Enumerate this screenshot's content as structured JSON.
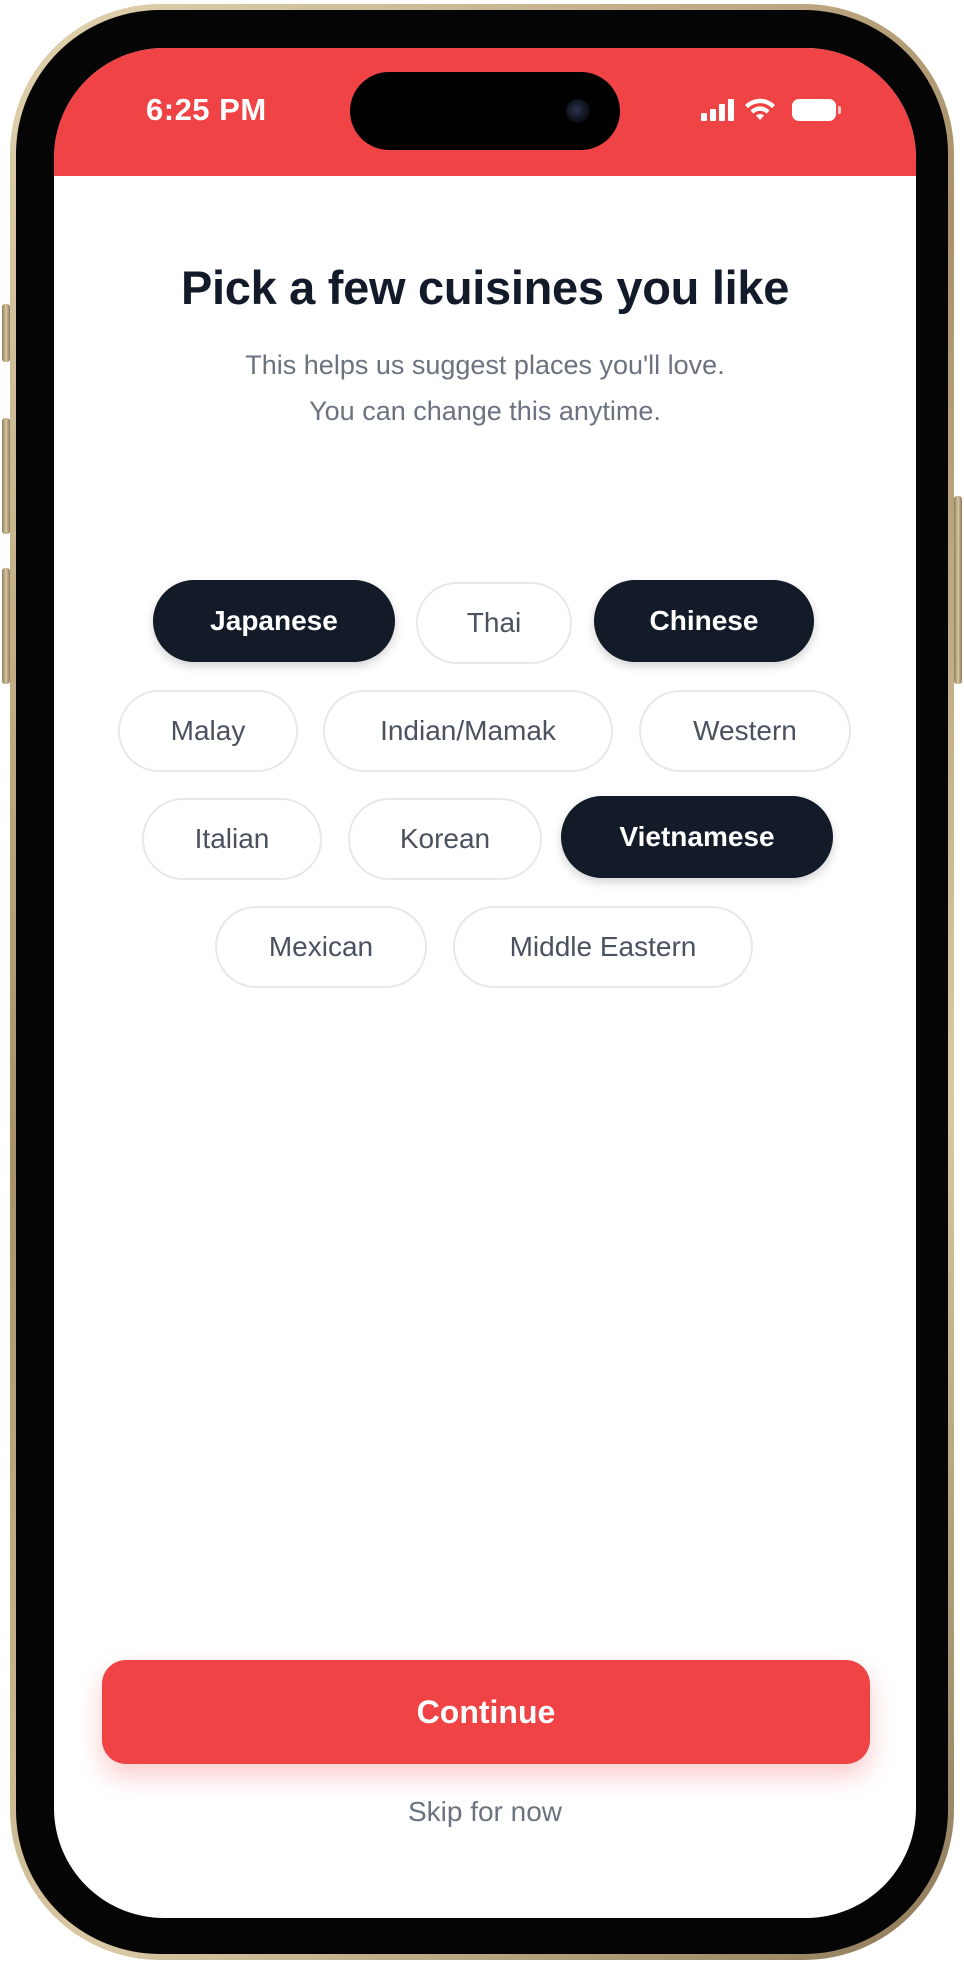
{
  "status_bar": {
    "time": "6:25 PM",
    "background_color": "#ef4346",
    "icons": [
      "cellular-signal-icon",
      "wifi-icon",
      "battery-icon"
    ]
  },
  "onboarding": {
    "title": "Pick a few cuisines you like",
    "subtitle_line1": "This helps us suggest places you'll love.",
    "subtitle_line2": "You can change this anytime."
  },
  "cuisines": [
    {
      "label": "Japanese",
      "selected": true
    },
    {
      "label": "Thai",
      "selected": false
    },
    {
      "label": "Chinese",
      "selected": true
    },
    {
      "label": "Malay",
      "selected": false
    },
    {
      "label": "Indian/Mamak",
      "selected": false
    },
    {
      "label": "Western",
      "selected": false
    },
    {
      "label": "Italian",
      "selected": false
    },
    {
      "label": "Korean",
      "selected": false
    },
    {
      "label": "Vietnamese",
      "selected": true
    },
    {
      "label": "Mexican",
      "selected": false
    },
    {
      "label": "Middle Eastern",
      "selected": false
    }
  ],
  "actions": {
    "continue_label": "Continue",
    "skip_label": "Skip for now"
  },
  "colors": {
    "accent": "#ef4346",
    "chip_selected": "#131a28",
    "chip_unselected_border": "#e6e8ec",
    "title": "#131a2a",
    "muted_text": "#6b7280"
  }
}
